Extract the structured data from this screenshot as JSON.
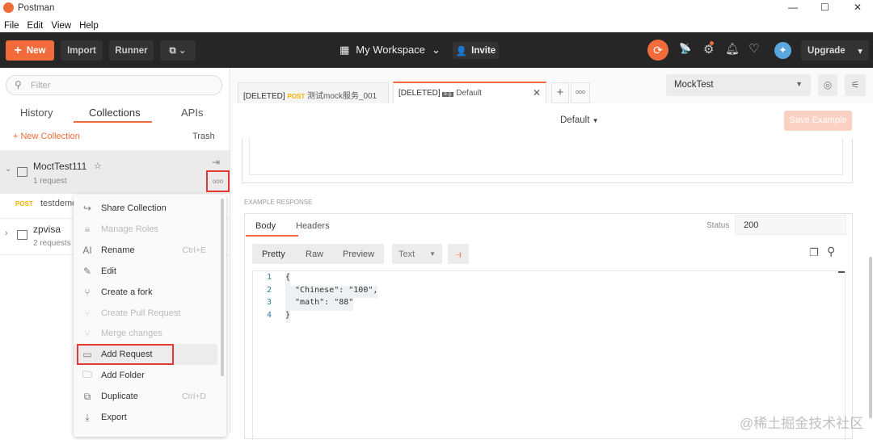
{
  "window": {
    "title": "Postman",
    "min": "—",
    "max": "☐",
    "close": "✕"
  },
  "menu": [
    "File",
    "Edit",
    "View",
    "Help"
  ],
  "toolbar": {
    "new": "New",
    "import": "Import",
    "runner": "Runner",
    "workspace": "My Workspace",
    "invite": "Invite",
    "upgrade": "Upgrade"
  },
  "sidebar": {
    "filter_placeholder": "Filter",
    "tabs": [
      "History",
      "Collections",
      "APIs"
    ],
    "new_collection": "New Collection",
    "trash": "Trash",
    "collections": [
      {
        "name": "MoctTest111",
        "count": "1 request"
      },
      {
        "name": "zpvisa",
        "count": "2 requests"
      }
    ],
    "request": {
      "method": "POST",
      "name": "testdemo"
    }
  },
  "context_menu": [
    {
      "label": "Share Collection",
      "icon": "share-icon",
      "disabled": false,
      "shortcut": ""
    },
    {
      "label": "Manage Roles",
      "icon": "lock-icon",
      "disabled": true,
      "shortcut": ""
    },
    {
      "label": "Rename",
      "icon": "rename-icon",
      "disabled": false,
      "shortcut": "Ctrl+E"
    },
    {
      "label": "Edit",
      "icon": "pencil-icon",
      "disabled": false,
      "shortcut": ""
    },
    {
      "label": "Create a fork",
      "icon": "fork-icon",
      "disabled": false,
      "shortcut": ""
    },
    {
      "label": "Create Pull Request",
      "icon": "pull-request-icon",
      "disabled": true,
      "shortcut": ""
    },
    {
      "label": "Merge changes",
      "icon": "merge-icon",
      "disabled": true,
      "shortcut": ""
    },
    {
      "label": "Add Request",
      "icon": "get-icon",
      "disabled": false,
      "shortcut": ""
    },
    {
      "label": "Add Folder",
      "icon": "folder-add-icon",
      "disabled": false,
      "shortcut": ""
    },
    {
      "label": "Duplicate",
      "icon": "duplicate-icon",
      "disabled": false,
      "shortcut": "Ctrl+D"
    },
    {
      "label": "Export",
      "icon": "export-icon",
      "disabled": false,
      "shortcut": ""
    }
  ],
  "tabs": [
    {
      "prefix": "[DELETED]",
      "method": "POST",
      "name": "测试mock服务_001"
    },
    {
      "prefix": "[DELETED]",
      "badge": "e.g.",
      "name": "Default"
    }
  ],
  "environment": "MockTest",
  "example": {
    "name": "Default",
    "save": "Save Example",
    "section_label": "EXAMPLE RESPONSE",
    "tabs": [
      "Body",
      "Headers"
    ],
    "status_label": "Status",
    "status_value": "200",
    "modes": [
      "Pretty",
      "Raw",
      "Preview"
    ],
    "format": "Text",
    "code": [
      {
        "n": "1",
        "t": "{"
      },
      {
        "n": "2",
        "t": "  \"Chinese\": \"100\","
      },
      {
        "n": "3",
        "t": "  \"math\": \"88\""
      },
      {
        "n": "4",
        "t": "}"
      }
    ]
  },
  "watermark": "@稀土掘金技术社区",
  "colors": {
    "accent": "#f26b3a",
    "dark": "#262626"
  }
}
